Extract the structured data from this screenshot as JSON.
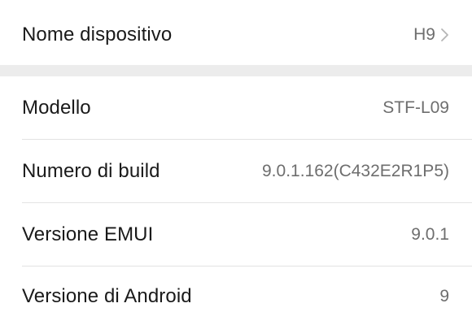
{
  "settings": {
    "rows": [
      {
        "label": "Nome dispositivo",
        "value": "H9"
      },
      {
        "label": "Modello",
        "value": "STF-L09"
      },
      {
        "label": "Numero di build",
        "value": "9.0.1.162(C432E2R1P5)"
      },
      {
        "label": "Versione EMUI",
        "value": "9.0.1"
      },
      {
        "label": "Versione di Android",
        "value": "9"
      }
    ]
  },
  "icons": {
    "chevron": "chevron-right-icon"
  }
}
